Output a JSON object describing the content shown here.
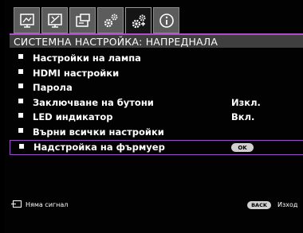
{
  "tabs": [
    {
      "icon": "display-icon",
      "active": false
    },
    {
      "icon": "picture-icon",
      "active": false
    },
    {
      "icon": "source-icon",
      "active": false
    },
    {
      "icon": "system-basic-icon",
      "active": false
    },
    {
      "icon": "system-advanced-icon",
      "active": true
    },
    {
      "icon": "info-icon",
      "active": false
    }
  ],
  "header": {
    "title": "СИСТЕМНА НАСТРОЙКА: НАПРЕДНАЛА"
  },
  "menu": {
    "items": [
      {
        "label": "Настройки на лампа",
        "value": ""
      },
      {
        "label": "HDMI настройки",
        "value": ""
      },
      {
        "label": "Парола",
        "value": ""
      },
      {
        "label": "Заключване на бутони",
        "value": "Изкл."
      },
      {
        "label": "LED индикатор",
        "value": "Вкл."
      },
      {
        "label": "Върни всички настройки",
        "value": ""
      },
      {
        "label": "Надстройка на фърмуер",
        "value": "",
        "button": "OK"
      }
    ],
    "bullet": "▪"
  },
  "footer": {
    "signal_text": "Няма сигнал",
    "back_label": "BACK",
    "exit_text": "Изход"
  },
  "colors": {
    "accent": "#b44ad0",
    "header_bg": "#3f3f3f",
    "tab_bg": "#5c5c5c"
  }
}
